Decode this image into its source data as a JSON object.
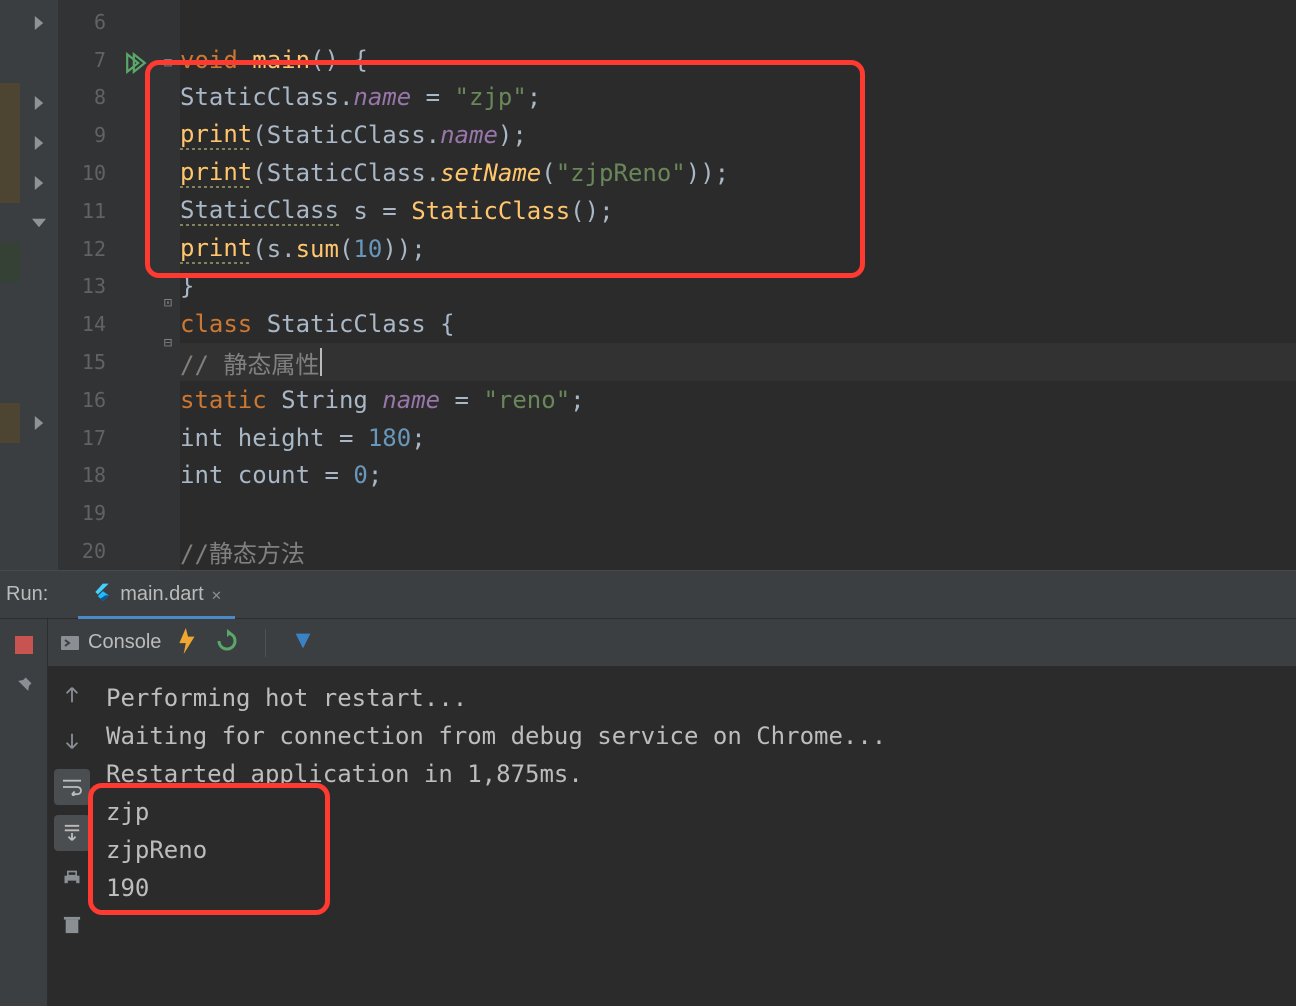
{
  "editor": {
    "lines": [
      {
        "num": "6"
      },
      {
        "num": "7"
      },
      {
        "num": "8"
      },
      {
        "num": "9"
      },
      {
        "num": "10"
      },
      {
        "num": "11"
      },
      {
        "num": "12"
      },
      {
        "num": "13"
      },
      {
        "num": "14"
      },
      {
        "num": "15"
      },
      {
        "num": "16"
      },
      {
        "num": "17"
      },
      {
        "num": "18"
      },
      {
        "num": "19"
      },
      {
        "num": "20"
      }
    ],
    "code": {
      "l7": {
        "kw": "void",
        "fn": "main",
        "punc": "() {"
      },
      "l8": {
        "lhs": "StaticClass.",
        "field": "name",
        "eq": " = ",
        "str": "\"zjp\"",
        "semi": ";"
      },
      "l9": {
        "fn": "print",
        "open": "(",
        "inner": "StaticClass.",
        "field": "name",
        "close": ")",
        "semi": ";"
      },
      "l10": {
        "fn": "print",
        "open": "(",
        "inner": "StaticClass.",
        "method": "setName",
        "args_open": "(",
        "str": "\"zjpReno\"",
        "args_close": "))",
        "semi": ";"
      },
      "l11": {
        "type": "StaticClass",
        "var": " s = ",
        "ctor": "StaticClass",
        "call": "()",
        "semi": ";"
      },
      "l12": {
        "fn": "print",
        "open": "(",
        "var": "s.",
        "method": "sum",
        "args_open": "(",
        "num": "10",
        "args_close": "))",
        "semi": ";"
      },
      "l13": {
        "close": "}"
      },
      "l14": {
        "kw": "class",
        "name": " StaticClass ",
        "open": "{"
      },
      "l15": {
        "comment": "// 静态属性"
      },
      "l16": {
        "kw": "static",
        "type": " String ",
        "field": "name",
        "eq": " = ",
        "str": "\"reno\"",
        "semi": ";"
      },
      "l17": {
        "type": "int ",
        "field": "height",
        "eq": " = ",
        "num": "180",
        "semi": ";"
      },
      "l18": {
        "type": "int ",
        "field": "count",
        "eq": " = ",
        "num": "0",
        "semi": ";"
      },
      "l20": {
        "comment": "//静态方法"
      }
    }
  },
  "run": {
    "label": "Run:",
    "tab": "main.dart",
    "console_label": "Console",
    "output": {
      "l1": "Performing hot restart...",
      "l2": "Waiting for connection from debug service on Chrome...",
      "l3": "Restarted application in 1,875ms.",
      "l4": "zjp",
      "l5": "zjpReno",
      "l6": "190"
    }
  }
}
